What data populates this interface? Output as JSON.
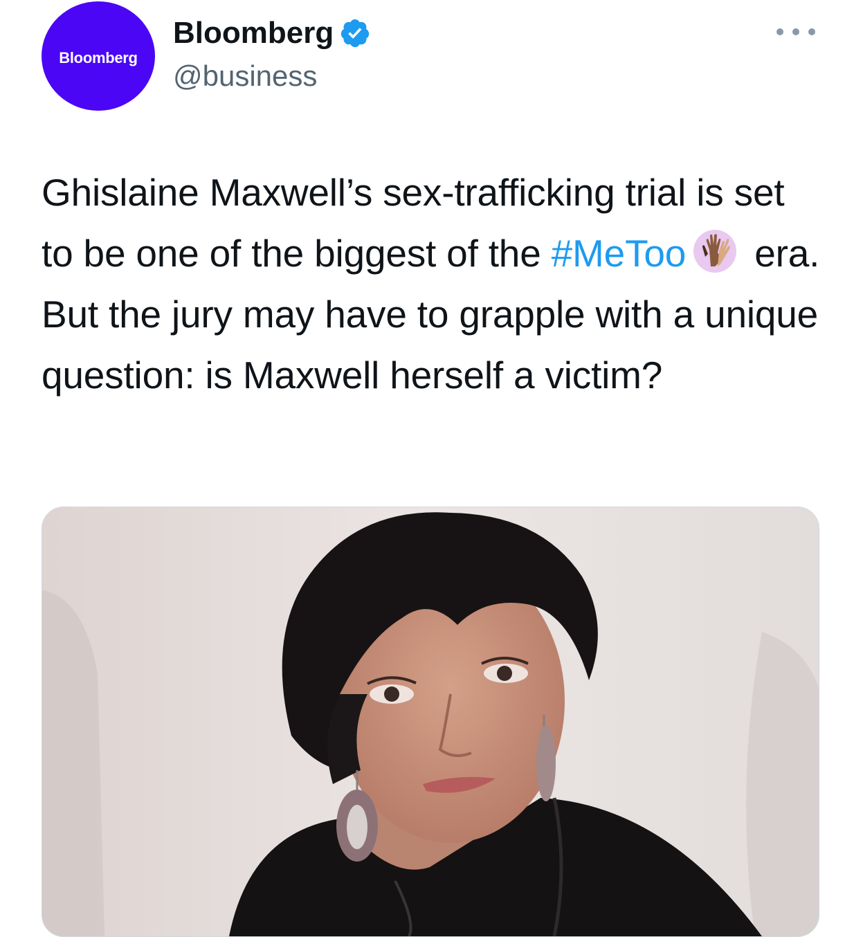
{
  "tweet": {
    "author": {
      "avatar_text": "Bloomberg",
      "display_name": "Bloomberg",
      "handle": "@business",
      "verified": true
    },
    "text": {
      "before_hashtag": "Ghislaine Maxwell’s sex-trafficking trial is set to be one of the biggest of the ",
      "hashtag": "#MeToo",
      "after_hashtag": " era. But the jury may have to grapple with a unique question: is Maxwell herself a victim?"
    },
    "icons": {
      "verified": "verified-badge-icon",
      "more": "more-options-icon",
      "hashtag_emoji": "raised-hands-emoji-icon"
    },
    "colors": {
      "avatar_bg": "#4a06f5",
      "hashtag": "#1d9bf0",
      "verified": "#1d9bf0",
      "text": "#0f1419",
      "secondary": "#536471"
    }
  }
}
